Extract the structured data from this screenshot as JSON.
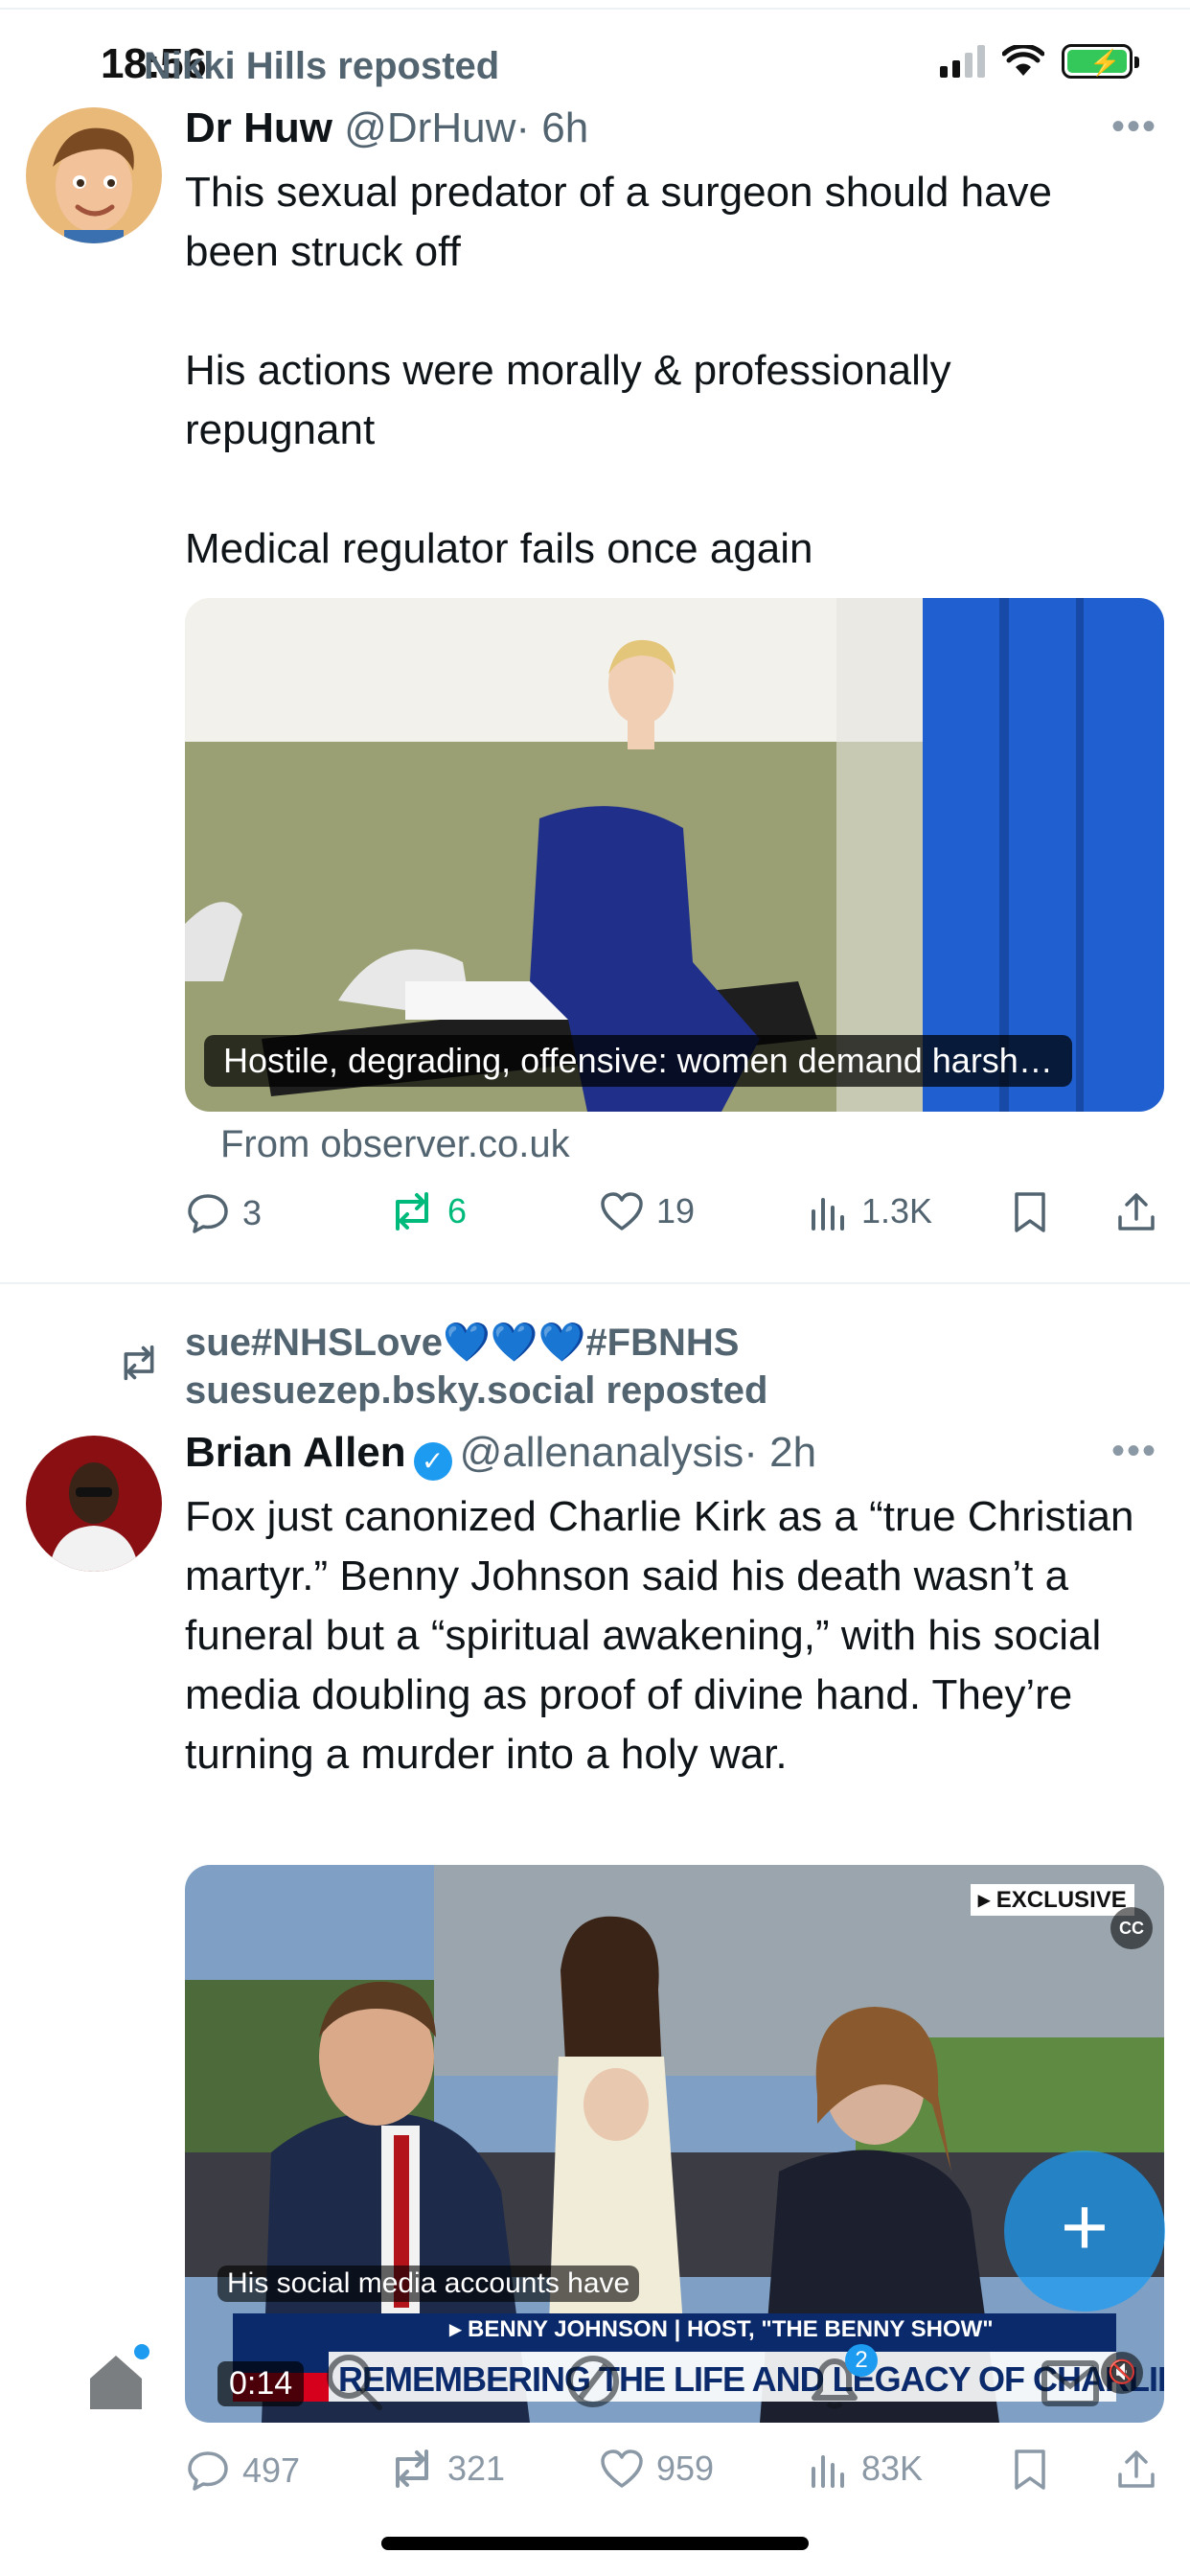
{
  "status_bar": {
    "time": "18:56"
  },
  "posts": [
    {
      "reposted_by": "Nikki Hills reposted",
      "author_name": "Dr Huw",
      "handle": "@DrHuw",
      "time": "· 6h",
      "paragraphs": [
        "This sexual predator of a surgeon should have been struck off",
        "His actions were morally & professionally repugnant",
        "Medical regulator fails once again"
      ],
      "link_caption": "Hostile, degrading, offensive: women demand harsh…",
      "link_source": "From observer.co.uk",
      "counts": {
        "replies": "3",
        "reposts": "6",
        "likes": "19",
        "views": "1.3K"
      }
    },
    {
      "reposted_by_line1": "sue#NHSLove💙💙💙#FBNHS",
      "reposted_by_line2": "suesuezep.bsky.social reposted",
      "author_name": "Brian Allen",
      "handle": "@allenanalysis",
      "time": "· 2h",
      "text": "Fox just canonized Charlie Kirk as a “true Christian martyr.” Benny Johnson said his death wasn’t a funeral but a “spiritual awakening,” with his social media doubling as proof of divine hand. They’re turning a murder into a holy war.",
      "video": {
        "subtitle": "His social media accounts have",
        "timestamp": "0:14",
        "badge_exclusive": "EXCLUSIVE",
        "chyron_name": "BENNY JOHNSON | HOST, \"THE BENNY SHOW\"",
        "chyron_headline": "REMEMBERING THE LIFE AND LEGACY OF CHARLIE KIRK",
        "cc": "CC"
      },
      "counts": {
        "replies": "497",
        "reposts": "321",
        "likes": "959",
        "views": "83K"
      }
    }
  ],
  "fab": {
    "label": "+"
  }
}
